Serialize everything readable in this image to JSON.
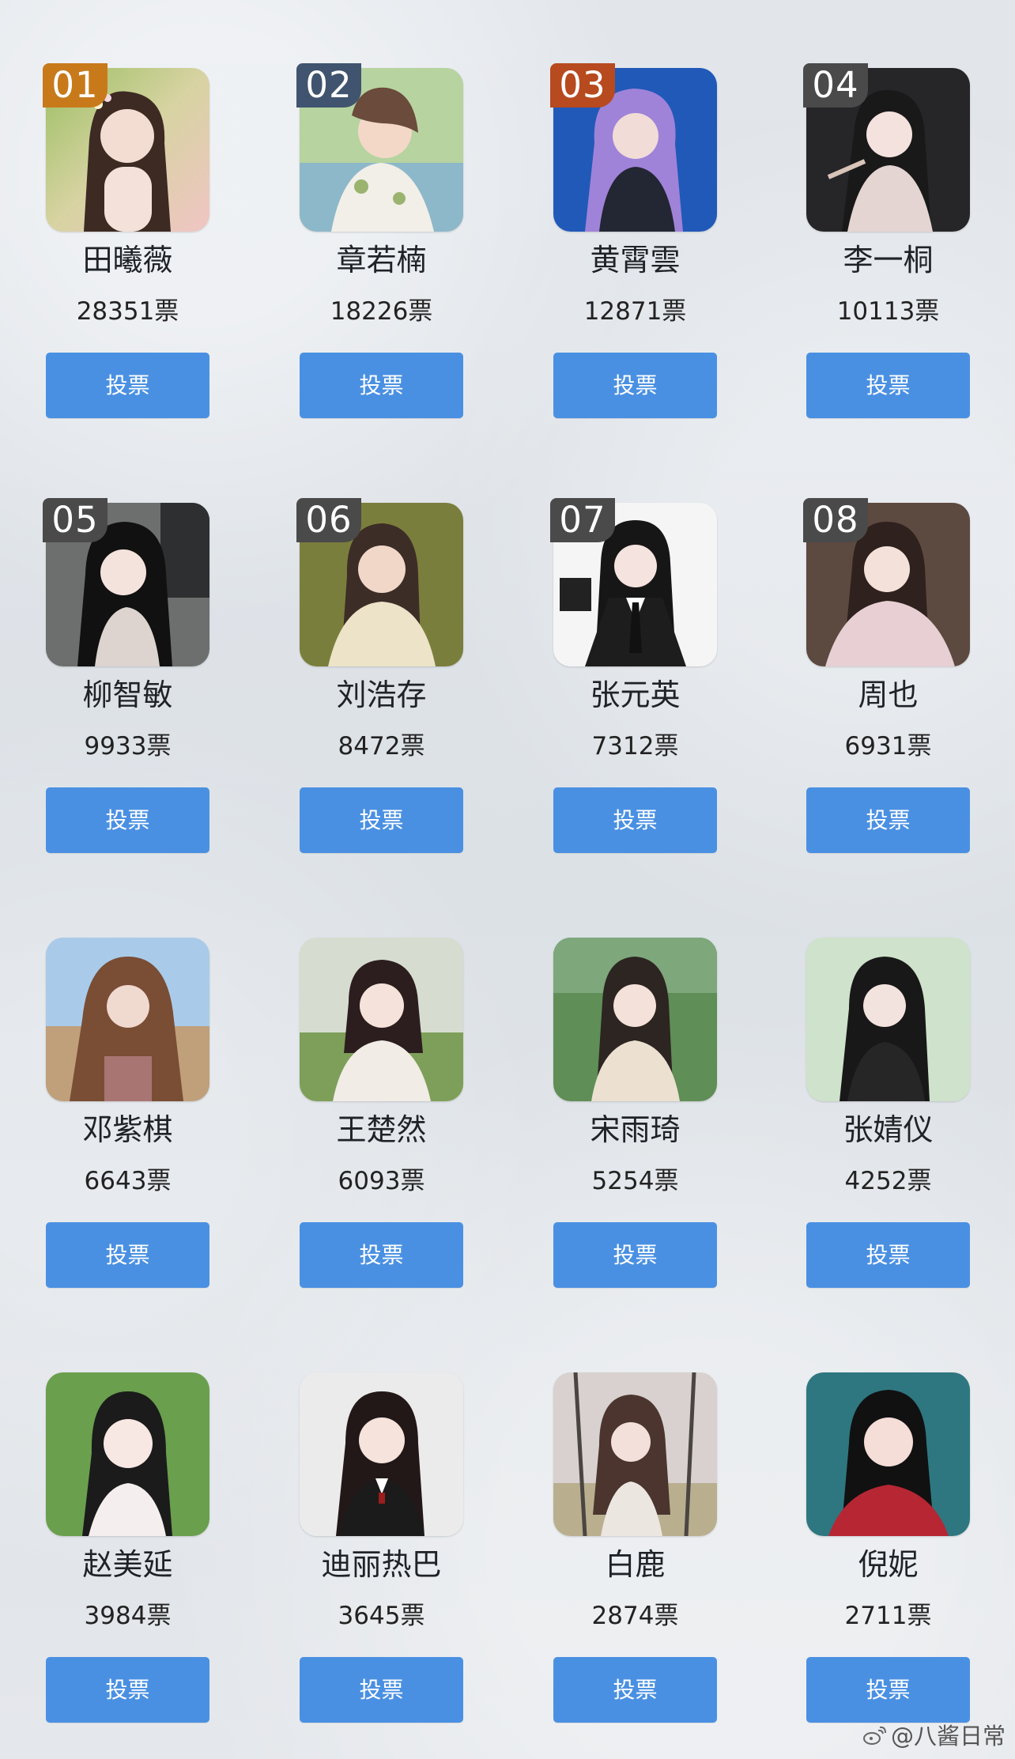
{
  "cards": [
    {
      "rank": "01",
      "name": "田曦薇",
      "votes": "28351票",
      "button": "投票",
      "rank_color": "#c87a1b",
      "avatar": "photo-1"
    },
    {
      "rank": "02",
      "name": "章若楠",
      "votes": "18226票",
      "button": "投票",
      "rank_color": "#40546f",
      "avatar": "photo-2"
    },
    {
      "rank": "03",
      "name": "黄霄雲",
      "votes": "12871票",
      "button": "投票",
      "rank_color": "#b74a1f",
      "avatar": "photo-3"
    },
    {
      "rank": "04",
      "name": "李一桐",
      "votes": "10113票",
      "button": "投票",
      "rank_color": "#4a4a4a",
      "avatar": "photo-4"
    },
    {
      "rank": "05",
      "name": "柳智敏",
      "votes": "9933票",
      "button": "投票",
      "rank_color": "#4a4a4a",
      "avatar": "photo-5"
    },
    {
      "rank": "06",
      "name": "刘浩存",
      "votes": "8472票",
      "button": "投票",
      "rank_color": "#4a4a4a",
      "avatar": "photo-6"
    },
    {
      "rank": "07",
      "name": "张元英",
      "votes": "7312票",
      "button": "投票",
      "rank_color": "#4a4a4a",
      "avatar": "photo-7"
    },
    {
      "rank": "08",
      "name": "周也",
      "votes": "6931票",
      "button": "投票",
      "rank_color": "#4a4a4a",
      "avatar": "photo-8"
    },
    {
      "rank": "",
      "name": "邓紫棋",
      "votes": "6643票",
      "button": "投票",
      "rank_color": "",
      "avatar": "photo-9"
    },
    {
      "rank": "",
      "name": "王楚然",
      "votes": "6093票",
      "button": "投票",
      "rank_color": "",
      "avatar": "photo-10"
    },
    {
      "rank": "",
      "name": "宋雨琦",
      "votes": "5254票",
      "button": "投票",
      "rank_color": "",
      "avatar": "photo-11"
    },
    {
      "rank": "",
      "name": "张婧仪",
      "votes": "4252票",
      "button": "投票",
      "rank_color": "",
      "avatar": "photo-12"
    },
    {
      "rank": "",
      "name": "赵美延",
      "votes": "3984票",
      "button": "投票",
      "rank_color": "",
      "avatar": "photo-13"
    },
    {
      "rank": "",
      "name": "迪丽热巴",
      "votes": "3645票",
      "button": "投票",
      "rank_color": "",
      "avatar": "photo-14"
    },
    {
      "rank": "",
      "name": "白鹿",
      "votes": "2874票",
      "button": "投票",
      "rank_color": "",
      "avatar": "photo-15"
    },
    {
      "rank": "",
      "name": "倪妮",
      "votes": "2711票",
      "button": "投票",
      "rank_color": "",
      "avatar": "photo-16"
    }
  ],
  "watermark": {
    "text": "@八酱日常",
    "icon": "weibo-icon"
  },
  "colors": {
    "button": "#4a90e2",
    "background": "#dfe3e8"
  }
}
